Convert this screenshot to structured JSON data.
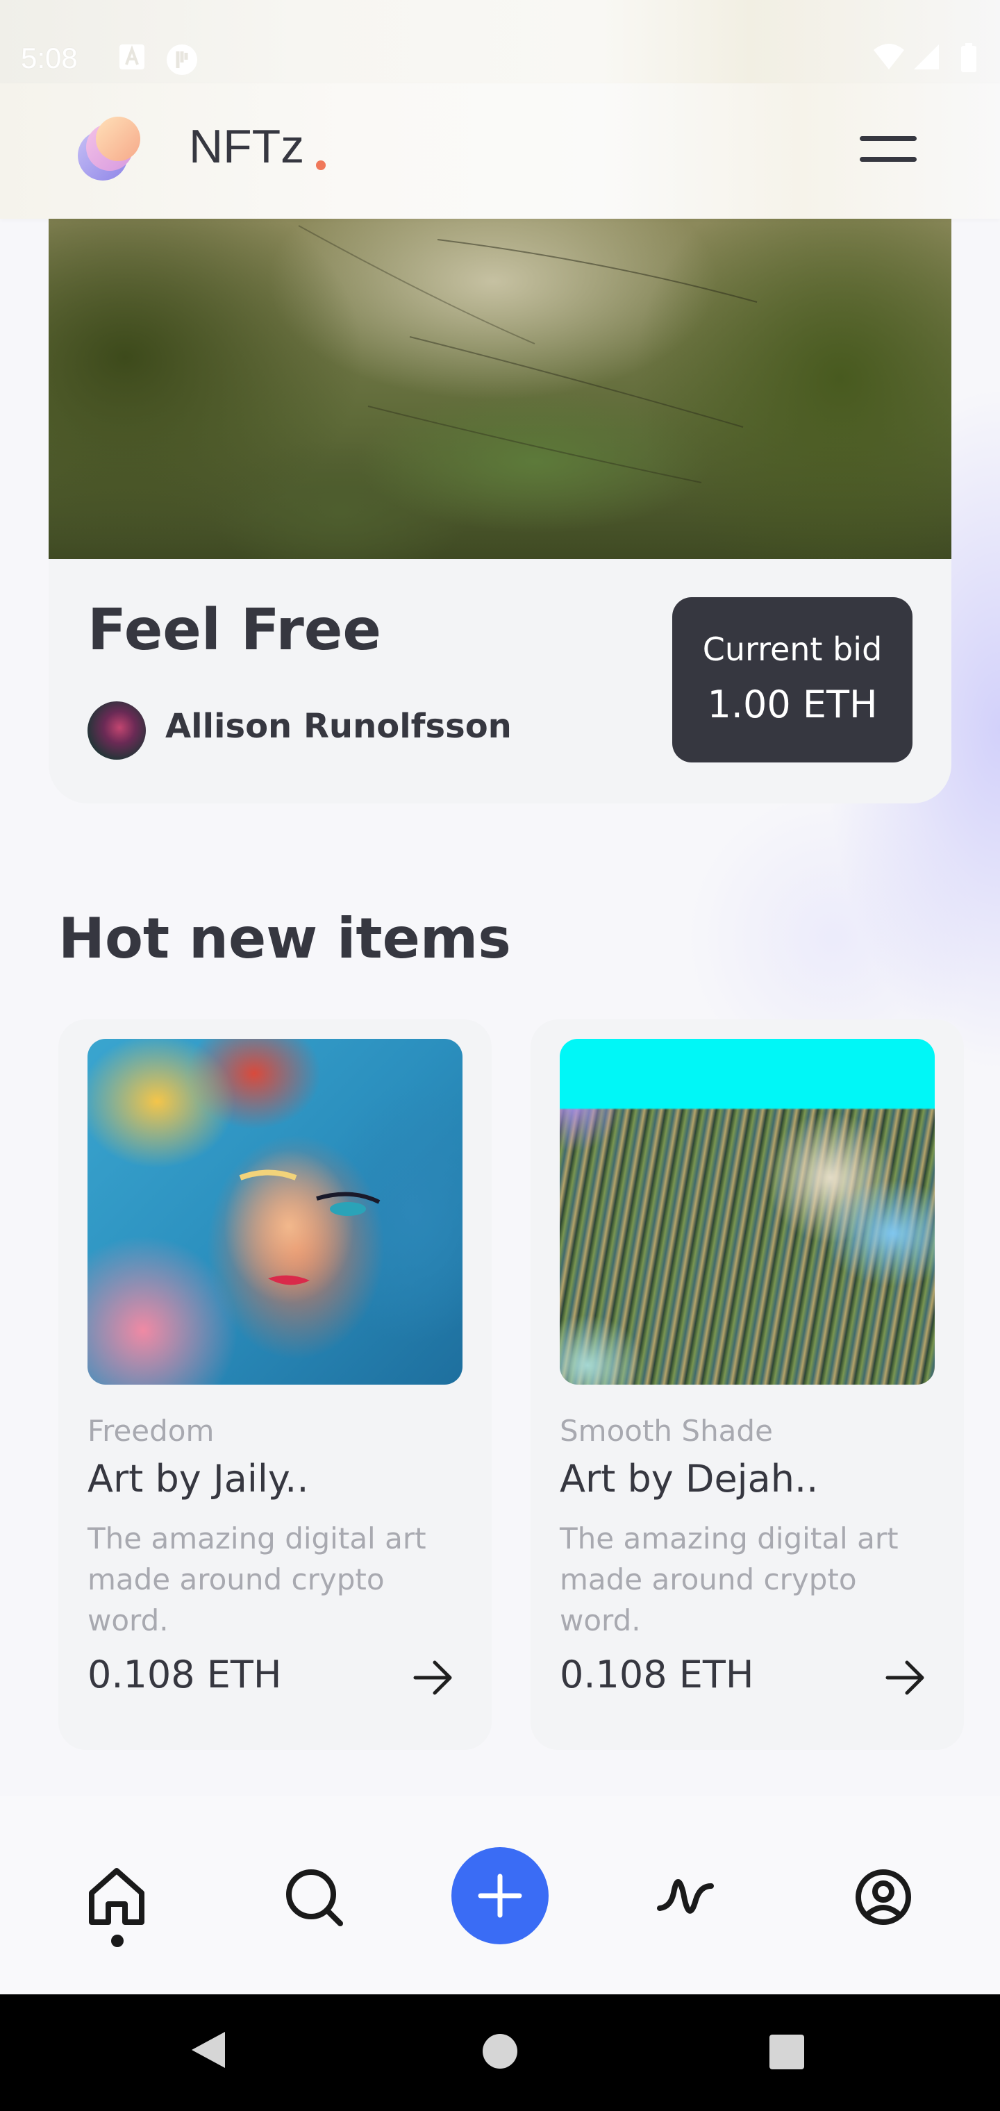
{
  "status_bar": {
    "time": "5:08",
    "icons": [
      "a-notification-icon",
      "app-notification-icon",
      "wifi-icon",
      "signal-icon",
      "battery-icon"
    ]
  },
  "header": {
    "brand": "NFTz",
    "logo_icon": "nftz-logo-icon",
    "menu_icon": "hamburger-menu-icon",
    "accent_color": "#f0785a"
  },
  "featured": {
    "title": "Feel Free",
    "author": "Allison Runolfsson",
    "bid_label": "Current bid",
    "bid_value": "1.00 ETH"
  },
  "hot_items": {
    "title": "Hot new items",
    "items": [
      {
        "category": "Freedom",
        "title": "Art by Jaily..",
        "description": "The amazing digital art made around crypto word.",
        "price": "0.108 ETH"
      },
      {
        "category": "Smooth Shade",
        "title": "Art by Dejah..",
        "description": "The amazing digital art made around crypto word.",
        "price": "0.108 ETH"
      }
    ]
  },
  "bottom_nav": {
    "items": [
      "home-icon",
      "search-icon",
      "add-icon",
      "activity-icon",
      "profile-icon"
    ],
    "active": "home-icon",
    "add_color": "#3a6cf5"
  },
  "system_nav": [
    "back-icon",
    "home-circle-icon",
    "recents-icon"
  ]
}
